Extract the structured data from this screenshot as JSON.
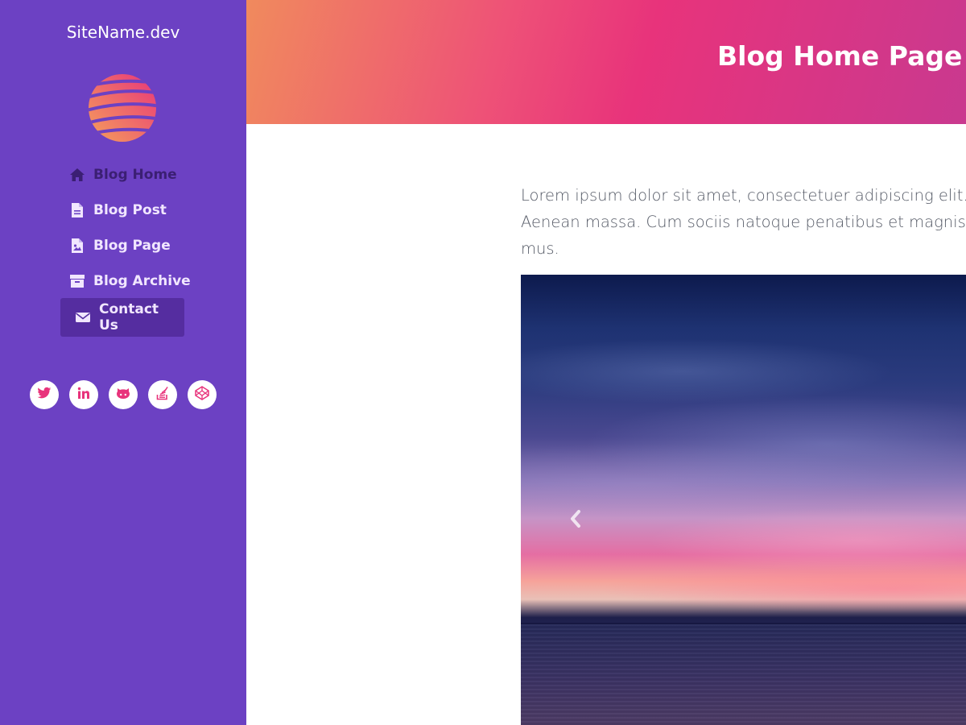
{
  "sidebar": {
    "site_name": "SiteName.dev",
    "logo_icon": "striped-globe-logo",
    "nav": [
      {
        "label": "Blog Home",
        "icon": "home-icon",
        "active": true
      },
      {
        "label": "Blog Post",
        "icon": "file-icon"
      },
      {
        "label": "Blog Page",
        "icon": "image-file-icon"
      },
      {
        "label": "Blog Archive",
        "icon": "archive-icon"
      },
      {
        "label": "Contact Us",
        "icon": "envelope-icon",
        "highlighted": true
      }
    ],
    "social": [
      "twitter-icon",
      "linkedin-icon",
      "github-icon",
      "stackoverflow-icon",
      "codepen-icon"
    ]
  },
  "header": {
    "title": "Blog Home Page H"
  },
  "main": {
    "intro_lines": [
      "Lorem ipsum dolor sit amet, consectetuer adipiscing elit. Aer",
      "Aenean massa. Cum sociis natoque penatibus et magnis dis",
      "mus."
    ],
    "carousel": {
      "prev_icon": "chevron-left-icon"
    }
  },
  "colors": {
    "sidebar_bg": "#6c41c3",
    "accent": "#e8337b",
    "contact_bg": "#552da0"
  }
}
